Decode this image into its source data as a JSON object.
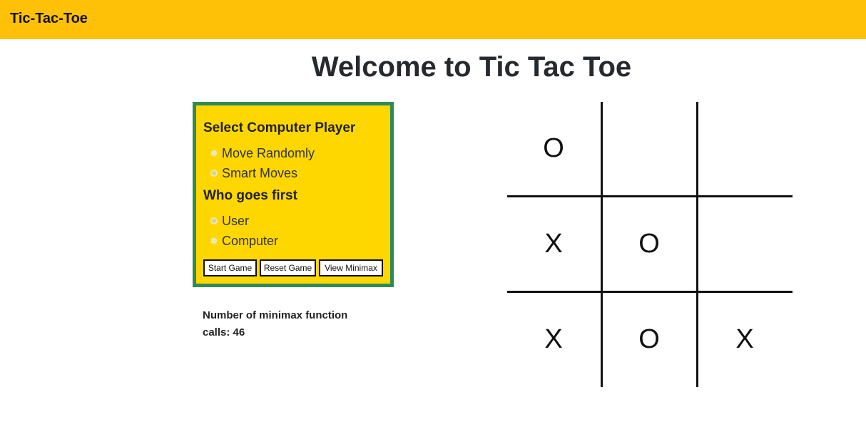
{
  "navbar": {
    "brand": "Tic-Tac-Toe"
  },
  "page": {
    "title": "Welcome to Tic Tac Toe"
  },
  "settings": {
    "computer_player_heading": "Select Computer Player",
    "computer_player_options": [
      "Move Randomly",
      "Smart Moves"
    ],
    "computer_player_selected": "Smart Moves",
    "first_player_heading": "Who goes first",
    "first_player_options": [
      "User",
      "Computer"
    ],
    "first_player_selected": "User",
    "buttons": {
      "start": "Start Game",
      "reset": "Reset Game",
      "minimax": "View Minimax"
    }
  },
  "stats": {
    "calls_text": "Number of minimax function calls: 46"
  },
  "board": {
    "cells": [
      "O",
      "",
      "",
      "X",
      "O",
      "",
      "X",
      "O",
      "X"
    ]
  },
  "colors": {
    "navbar": "#ffc107",
    "panel_background": "#ffd700",
    "panel_border": "#2e8b57"
  }
}
